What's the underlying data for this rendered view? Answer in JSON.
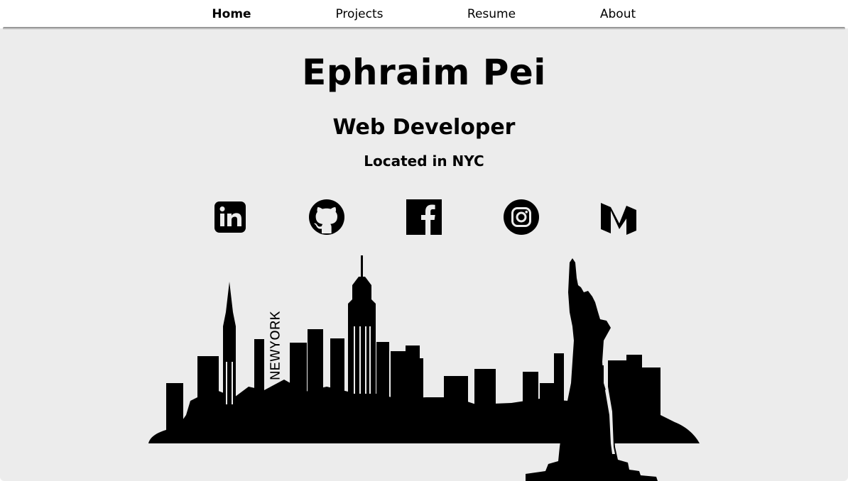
{
  "nav": {
    "items": [
      {
        "label": "Home",
        "active": true
      },
      {
        "label": "Projects",
        "active": false
      },
      {
        "label": "Resume",
        "active": false
      },
      {
        "label": "About",
        "active": false
      }
    ]
  },
  "hero": {
    "name": "Ephraim Pei",
    "role": "Web Developer",
    "location": "Located in NYC"
  },
  "social_icons": [
    "linkedin-icon",
    "github-icon",
    "facebook-icon",
    "instagram-icon",
    "medium-icon"
  ],
  "illustration": {
    "subject": "new-york-skyline-silhouette",
    "sign_text": "NEWYORK"
  },
  "colors": {
    "background": "#ececec",
    "nav_background": "#ffffff",
    "ink": "#000000"
  }
}
